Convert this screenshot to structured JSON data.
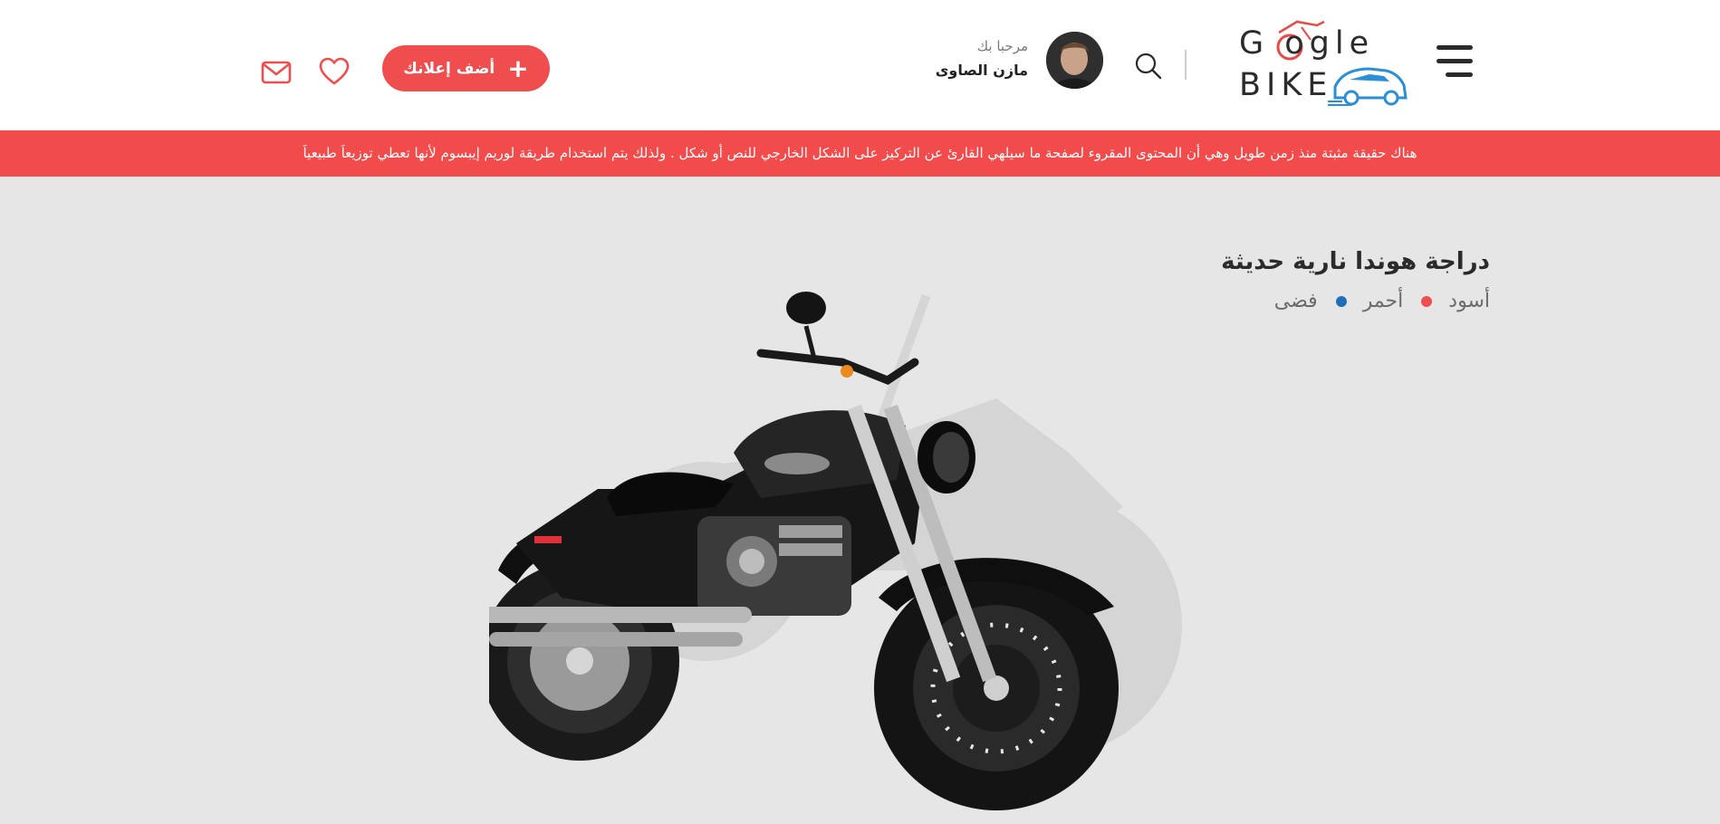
{
  "header": {
    "logo": {
      "line1": "G   ogle",
      "line2": "BIKE"
    },
    "user": {
      "greeting": "مرحبا بك",
      "name": "مازن الصاوى"
    },
    "add_button_label": "أضف إعلانك",
    "add_button_icon": "plus-icon",
    "icons": [
      "menu-icon",
      "search-icon",
      "heart-icon",
      "mail-icon"
    ]
  },
  "banner": {
    "text": "هناك حقيقة مثبتة منذ زمن طويل وهي أن المحتوى المقروء لصفحة ما سيلهي القارئ عن التركيز على الشكل الخارجي للنص أو شكل . ولذلك يتم استخدام طريقة لوريم إيبسوم لأنها تعطي توزيعاَ طبيعياَ"
  },
  "product": {
    "title": "دراجة هوندا نارية حديثة",
    "colors": [
      {
        "label": "أسود",
        "dot": "#f04e4e"
      },
      {
        "label": "أحمر",
        "dot": "#1f6fb8"
      },
      {
        "label": "فضى",
        "dot": null
      }
    ]
  },
  "colors": {
    "accent": "#f04e4e",
    "banner": "#f24b4c",
    "logo_blue": "#2a8fd6"
  }
}
